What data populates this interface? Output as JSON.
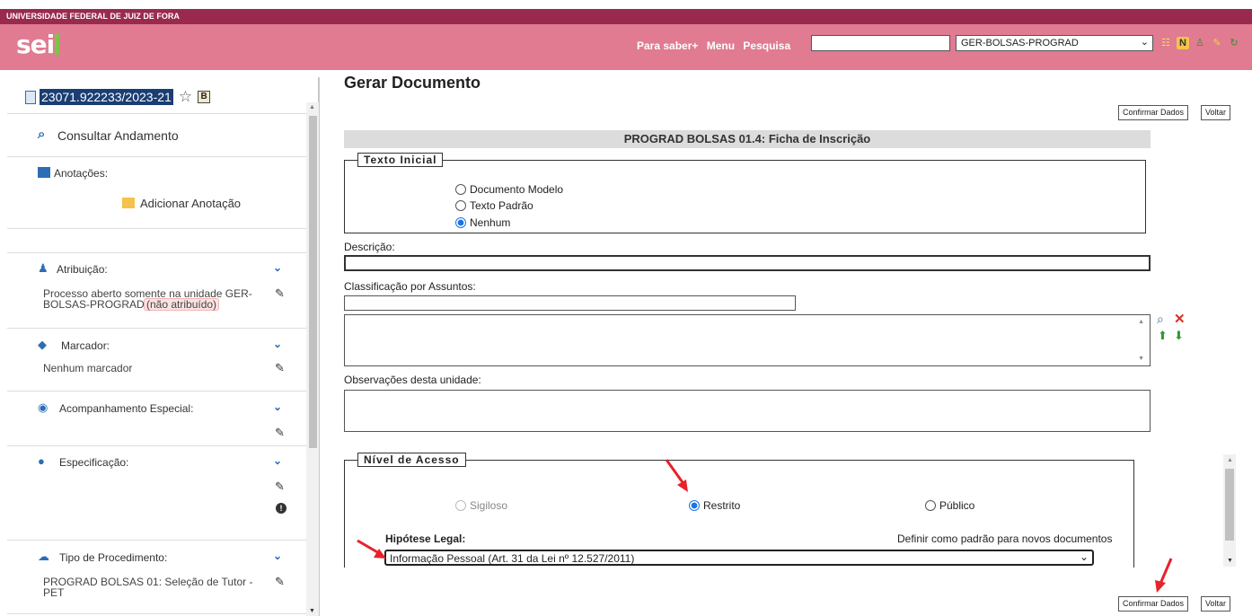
{
  "header": {
    "university": "UNIVERSIDADE FEDERAL DE JUIZ DE FORA",
    "logo": "sei",
    "links": [
      "Para saber+",
      "Menu",
      "Pesquisa"
    ],
    "search_value": "",
    "unit": "GER-BOLSAS-PROGRAD",
    "icons": [
      "grid-icon",
      "notes-icon",
      "user-icon",
      "tools-icon",
      "refresh-icon"
    ]
  },
  "sidebar": {
    "process_number": "23071.922233/2023-21",
    "badge": "B",
    "consultar": "Consultar Andamento",
    "anotacoes_title": "Anotações:",
    "adicionar_anotacao": "Adicionar Anotação",
    "atribuicao_title": "Atribuição:",
    "atribuicao_text1": "Processo aberto somente na unidade GER-",
    "atribuicao_text2": "BOLSAS-PROGRAD.",
    "nao_atribuido": "(não atribuído)",
    "marcador_title": "Marcador:",
    "marcador_text": "Nenhum marcador",
    "acompanhamento_title": "Acompanhamento Especial:",
    "especificacao_title": "Especificação:",
    "tipo_title": "Tipo de Procedimento:",
    "tipo_text1": "PROGRAD BOLSAS 01: Seleção de Tutor -",
    "tipo_text2": "PET"
  },
  "main": {
    "title": "Gerar Documento",
    "confirm_label": "Confirmar Dados",
    "back_label": "Voltar",
    "form_header": "PROGRAD BOLSAS 01.4: Ficha de Inscrição",
    "texto_inicial": {
      "legend": "Texto Inicial",
      "options": [
        "Documento Modelo",
        "Texto Padrão",
        "Nenhum"
      ],
      "selected": "Nenhum"
    },
    "descricao_label": "Descrição:",
    "descricao_value": "",
    "classificacao_label": "Classificação por Assuntos:",
    "observacoes_label": "Observações desta unidade:",
    "nivel_acesso": {
      "legend": "Nível de Acesso",
      "options": [
        "Sigiloso",
        "Restrito",
        "Público"
      ],
      "selected": "Restrito",
      "hipotese_label": "Hipótese Legal:",
      "padrao_link": "Definir como padrão para novos documentos",
      "hipotese_value": "Informação Pessoal (Art. 31 da Lei nº 12.527/2011)"
    }
  },
  "colors": {
    "header_bg": "#e07b91",
    "uni_bar": "#9a2a4d",
    "arrow": "#e8212a",
    "accent": "#2c6eb5"
  }
}
